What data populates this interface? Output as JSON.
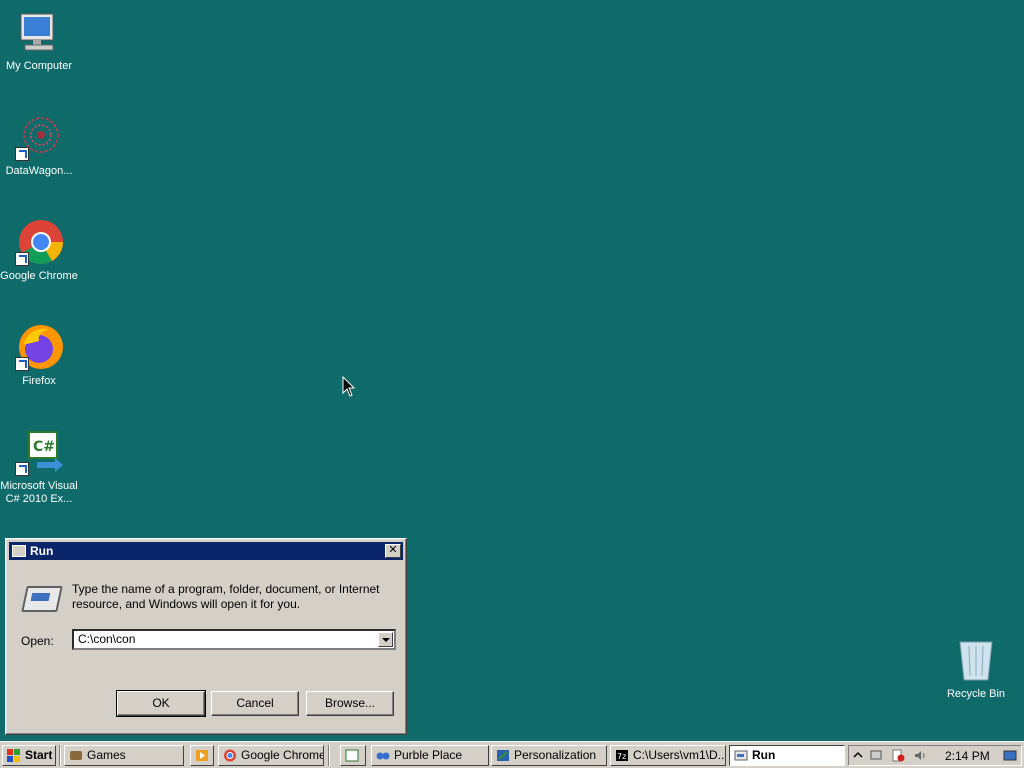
{
  "desktop": {
    "icons": [
      {
        "label": "My Computer"
      },
      {
        "label": "DataWagon..."
      },
      {
        "label": "Google Chrome"
      },
      {
        "label": "Firefox"
      },
      {
        "label": "Microsoft Visual C# 2010 Ex..."
      },
      {
        "label": "Recycle Bin"
      }
    ]
  },
  "run_dialog": {
    "title": "Run",
    "close_glyph": "✕",
    "description": "Type the name of a program, folder, document, or Internet resource, and Windows will open it for you.",
    "open_label": "Open:",
    "open_value": "C:\\con\\con",
    "ok_label": "OK",
    "cancel_label": "Cancel",
    "browse_label": "Browse..."
  },
  "taskbar": {
    "start_label": "Start",
    "items": [
      {
        "label": "Games",
        "icon": "games-icon"
      },
      {
        "label": "Google Chrome",
        "icon": "chrome-icon"
      },
      {
        "label": "Purble Place",
        "icon": "purble-place-icon"
      },
      {
        "label": "Personalization",
        "icon": "personalization-icon"
      },
      {
        "label": "C:\\Users\\vm1\\D...",
        "icon": "7zip-icon"
      },
      {
        "label": "Run",
        "icon": "run-icon",
        "active": true
      }
    ],
    "clock": "2:14 PM"
  },
  "colors": {
    "desktop_bg": "#0f6a6a",
    "titlebar": "#0a246a",
    "face": "#d4d0c8"
  }
}
